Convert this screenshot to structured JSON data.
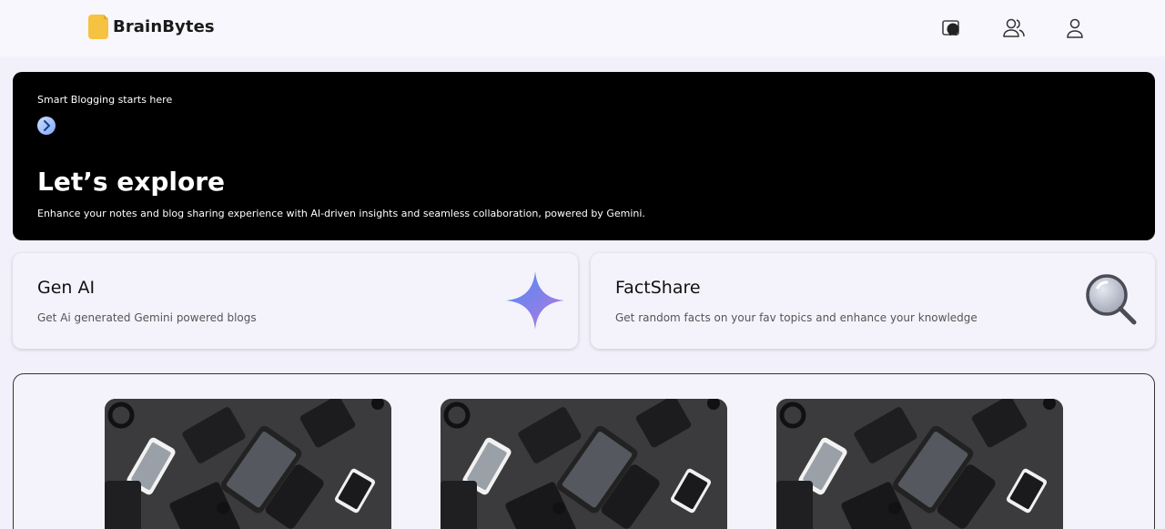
{
  "header": {
    "brand": "BrainBytes",
    "icons": [
      "github-icon",
      "users-icon",
      "user-icon"
    ]
  },
  "hero": {
    "tagline": "Smart Blogging starts here",
    "title": "Let’s explore",
    "description": "Enhance your notes and blog sharing experience with AI-driven insights and seamless collaboration, powered by Gemini."
  },
  "features": [
    {
      "title": "Gen AI",
      "description": "Get Ai generated Gemini powered blogs",
      "icon": "gemini-sparkle-icon"
    },
    {
      "title": "FactShare",
      "description": "Get random facts on your fav topics and enhance your knowledge",
      "icon": "magnifier-icon"
    }
  ],
  "colors": {
    "background": "#f2f1fb",
    "hero_bg": "#000000",
    "logo": "#f5c242",
    "accent": "#7da7ff"
  }
}
